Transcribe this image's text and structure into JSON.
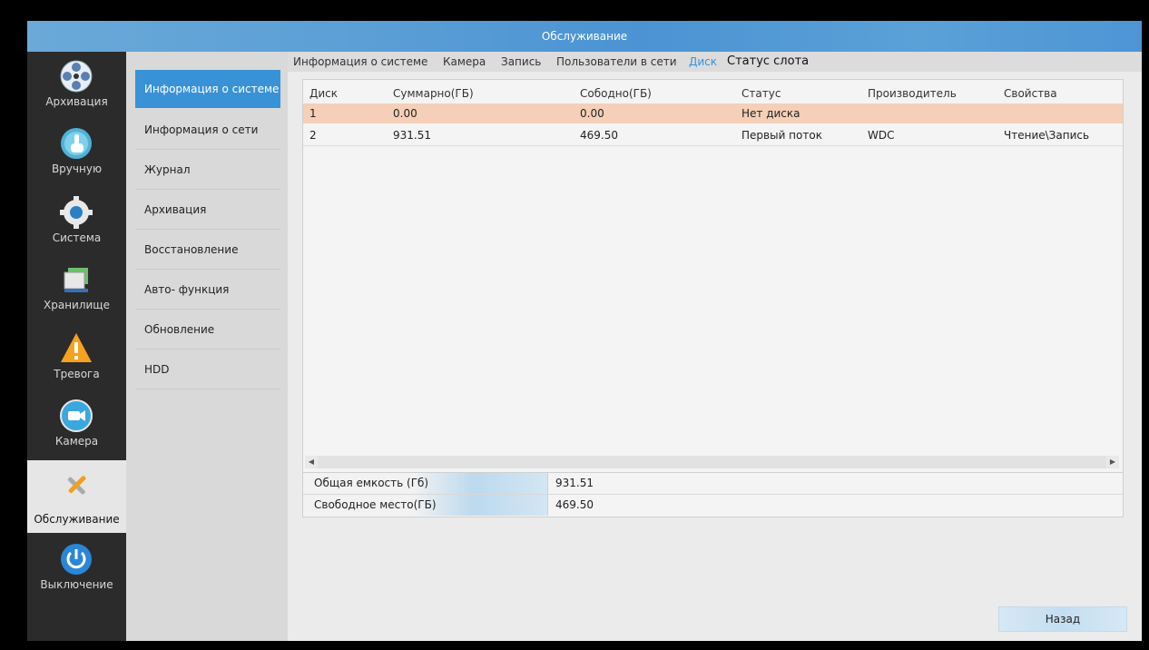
{
  "window": {
    "title": "Обслуживание"
  },
  "nav": [
    {
      "label": "Архивация",
      "icon": "film-reel-icon"
    },
    {
      "label": "Вручную",
      "icon": "hand-pointer-icon"
    },
    {
      "label": "Система",
      "icon": "gear-icon"
    },
    {
      "label": "Хранилище",
      "icon": "storage-icon"
    },
    {
      "label": "Тревога",
      "icon": "warning-icon"
    },
    {
      "label": "Камера",
      "icon": "camera-icon"
    },
    {
      "label": "Обслуживание",
      "icon": "tools-icon",
      "active": true
    },
    {
      "label": "Выключение",
      "icon": "power-icon"
    }
  ],
  "submenu": [
    {
      "label": "Информация о системе",
      "active": true
    },
    {
      "label": "Информация о сети"
    },
    {
      "label": "Журнал"
    },
    {
      "label": "Архивация"
    },
    {
      "label": "Восстановление"
    },
    {
      "label": "Авто- функция"
    },
    {
      "label": "Обновление"
    },
    {
      "label": "HDD"
    }
  ],
  "tabs": [
    {
      "label": "Информация о системе"
    },
    {
      "label": "Камера"
    },
    {
      "label": "Запись"
    },
    {
      "label": "Пользователи в сети"
    },
    {
      "label": "Диск",
      "active": true
    },
    {
      "label": "Статус слота"
    }
  ],
  "table": {
    "columns": [
      "Диск",
      "Суммарно(ГБ)",
      "Cободно(ГБ)",
      "Статус",
      "Производитель",
      "Свойства"
    ],
    "rows": [
      [
        "1",
        "0.00",
        "0.00",
        "Нет диска",
        "",
        ""
      ],
      [
        "2",
        "931.51",
        "469.50",
        "Первый поток",
        "WDC",
        "Чтение\\Запись"
      ]
    ]
  },
  "summary": {
    "total_label": "Общая емкость (Гб)",
    "total_value": "931.51",
    "free_label": "Свободное место(ГБ)",
    "free_value": "469.50"
  },
  "back_label": "Назад",
  "colors": {
    "accent": "#3a92d6",
    "selected_row": "#f5cfb8",
    "sidebar_dark": "#2b2b2b"
  }
}
